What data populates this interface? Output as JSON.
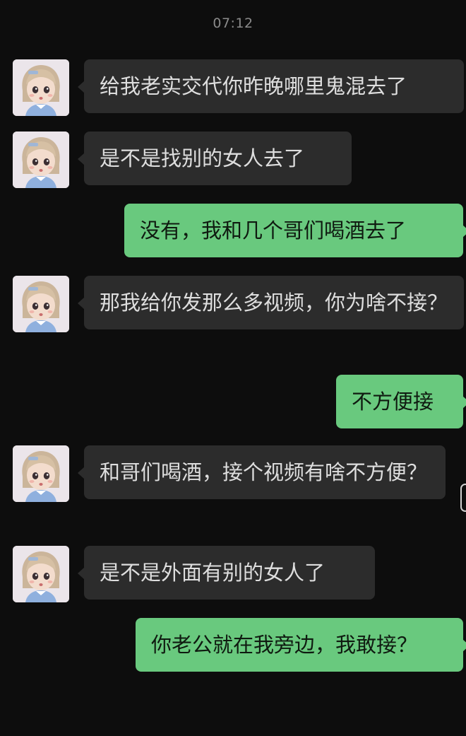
{
  "header": {
    "time": "07:12"
  },
  "colors": {
    "background": "#0d0d0d",
    "incoming_bubble": "#2c2c2c",
    "outgoing_bubble": "#69c97e"
  },
  "messages": [
    {
      "sender": "other",
      "text": "给我老实交代你昨晚哪里鬼混去了",
      "avatar_icon": "doll-avatar-icon"
    },
    {
      "sender": "other",
      "text": "是不是找别的女人去了",
      "avatar_icon": "doll-avatar-icon"
    },
    {
      "sender": "me",
      "text": "没有，我和几个哥们喝酒去了"
    },
    {
      "sender": "other",
      "text": "那我给你发那么多视频，你为啥不接？",
      "avatar_icon": "doll-avatar-icon"
    },
    {
      "sender": "me",
      "text": "不方便接"
    },
    {
      "sender": "other",
      "text": "和哥们喝酒，接个视频有啥不方便？",
      "avatar_icon": "doll-avatar-icon"
    },
    {
      "sender": "other",
      "text": "是不是外面有别的女人了",
      "avatar_icon": "doll-avatar-icon"
    },
    {
      "sender": "me",
      "text": "你老公就在我旁边，我敢接？"
    }
  ]
}
